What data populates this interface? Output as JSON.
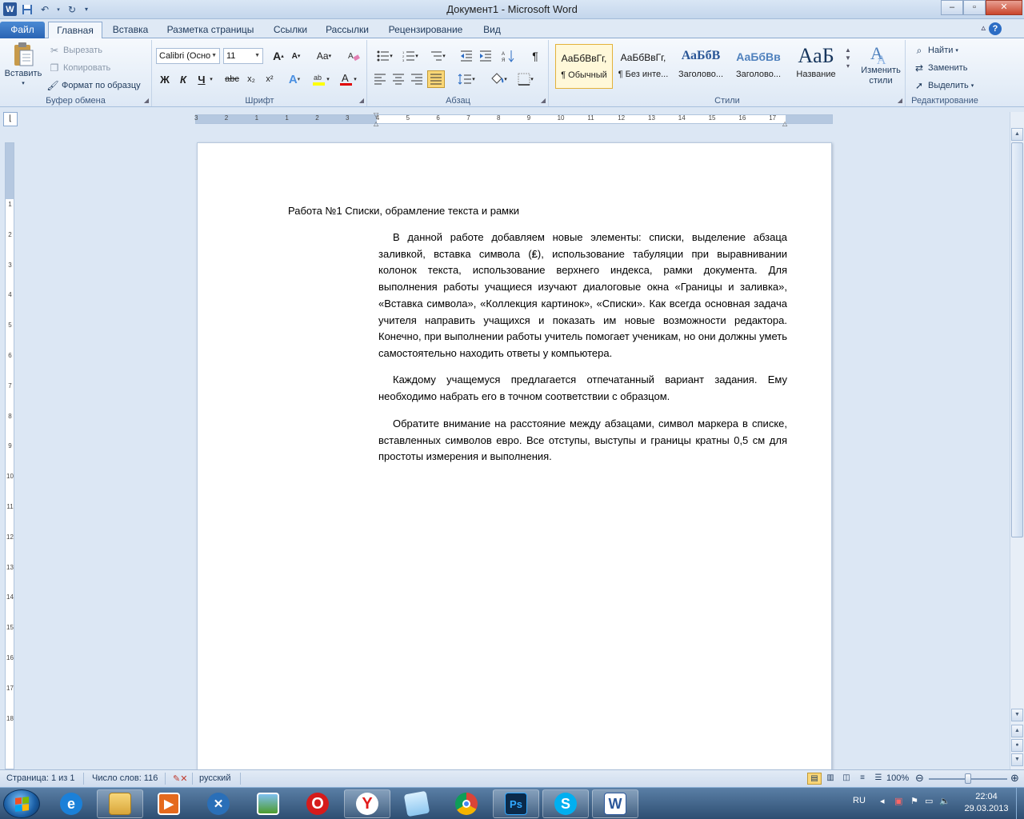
{
  "window": {
    "title": "Документ1  -  Microsoft Word",
    "logo": "W",
    "controls": {
      "minimize": "–",
      "maximize": "▫",
      "close": "✕"
    }
  },
  "tabs": [
    {
      "label": "Файл"
    },
    {
      "label": "Главная"
    },
    {
      "label": "Вставка"
    },
    {
      "label": "Разметка страницы"
    },
    {
      "label": "Ссылки"
    },
    {
      "label": "Рассылки"
    },
    {
      "label": "Рецензирование"
    },
    {
      "label": "Вид"
    }
  ],
  "ribbon": {
    "clipboard": {
      "label": "Буфер обмена",
      "paste": "Вставить",
      "cut": "Вырезать",
      "copy": "Копировать",
      "format_painter": "Формат по образцу"
    },
    "font": {
      "label": "Шрифт",
      "font_name": "Calibri (Осно",
      "font_size": "11",
      "bold": "Ж",
      "italic": "К",
      "underline": "Ч",
      "strike": "abc",
      "subscript": "x₂",
      "superscript": "x²",
      "grow": "A",
      "shrink": "A",
      "case": "Aa"
    },
    "paragraph": {
      "label": "Абзац"
    },
    "styles": {
      "label": "Стили",
      "items": [
        {
          "sample": "АаБбВвГг,",
          "name": "¶ Обычный"
        },
        {
          "sample": "АаБбВвГг,",
          "name": "¶ Без инте..."
        },
        {
          "sample": "АаБбВ",
          "name": "Заголово..."
        },
        {
          "sample": "АаБбВв",
          "name": "Заголово..."
        },
        {
          "sample": "AaБ",
          "name": "Название"
        }
      ],
      "change_styles": "Изменить стили"
    },
    "editing": {
      "label": "Редактирование",
      "find": "Найти",
      "replace": "Заменить",
      "select": "Выделить"
    }
  },
  "ruler": {
    "h_numbers": [
      "3",
      "2",
      "1",
      "1",
      "2",
      "3",
      "4",
      "5",
      "6",
      "7",
      "8",
      "9",
      "10",
      "11",
      "12",
      "13",
      "14",
      "15",
      "16",
      "17"
    ],
    "v_numbers": [
      "1",
      "2",
      "3",
      "4",
      "5",
      "6",
      "7",
      "8",
      "9",
      "10",
      "11",
      "12",
      "13",
      "14",
      "15",
      "16",
      "17",
      "18"
    ]
  },
  "document": {
    "title": "Работа №1 Списки, обрамление текста и рамки",
    "paragraphs": [
      "В данной работе добавляем новые элементы: списки, выделение абзаца заливкой, вставка символа (₤), использование табуляции при выравнивании колонок текста, использование верхнего индекса, рамки документа. Для выполнения работы учащиеся изучают диалоговые окна «Границы и заливка», «Вставка символа», «Коллекция картинок», «Списки». Как всегда основная задача учителя направить учащихся и показать им новые возможности редактора. Конечно, при выполнении  работы учитель помогает ученикам, но они должны уметь самостоятельно находить ответы у компьютера.",
      "Каждому учащемуся предлагается отпечатанный вариант задания. Ему необходимо набрать его в точном соответствии с образцом.",
      "Обратите внимание на расстояние между абзацами, символ маркера в списке, вставленных символов евро. Все отступы, выступы и границы кратны 0,5 см для простоты измерения и выполнения."
    ]
  },
  "statusbar": {
    "page": "Страница: 1 из 1",
    "words": "Число слов: 116",
    "language": "русский",
    "zoom": "100%",
    "zoom_level": 1.0
  },
  "taskbar": {
    "language": "RU",
    "time": "22:04",
    "date": "29.03.2013"
  },
  "colors": {
    "accent": "#2b579a",
    "selected_style": "#fbd777"
  }
}
